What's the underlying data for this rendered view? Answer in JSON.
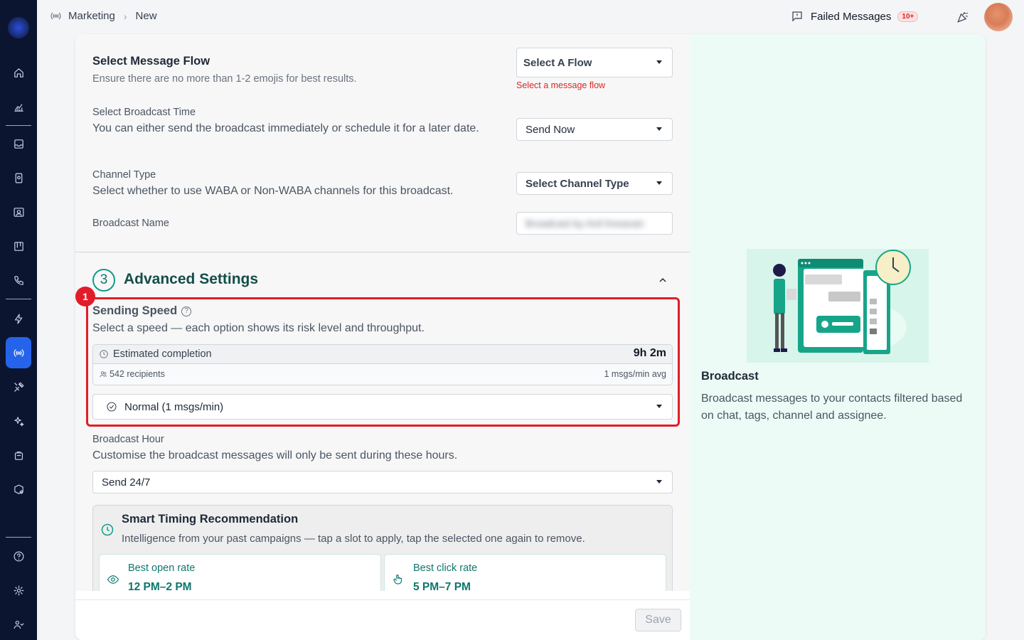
{
  "breadcrumb": {
    "section": "Marketing",
    "page": "New"
  },
  "header": {
    "failed_label": "Failed Messages",
    "failed_badge": "10+"
  },
  "sidebar": {
    "icons": [
      "home-icon",
      "analytics-icon",
      "inbox-icon",
      "contacts-icon",
      "contact-card-icon",
      "board-icon",
      "phone-icon",
      "bolt-icon",
      "broadcast-icon",
      "tools-icon",
      "sparkle-icon",
      "bag-icon",
      "package-settings-icon",
      "help-icon",
      "settings-icon",
      "team-icon"
    ],
    "active": "broadcast-icon"
  },
  "form": {
    "flow": {
      "title": "Select Message Flow",
      "hint": "Ensure there are no more than 1-2 emojis for best results.",
      "value": "Select A Flow",
      "error": "Select a message flow"
    },
    "time": {
      "label": "Select Broadcast Time",
      "desc": "You can either send the broadcast immediately or schedule it for a later date.",
      "value": "Send Now"
    },
    "channel": {
      "label": "Channel Type",
      "desc": "Select whether to use WABA or Non-WABA channels for this broadcast.",
      "value": "Select Channel Type"
    },
    "name": {
      "label": "Broadcast Name",
      "value": "Broadcast by Anil Kesavan"
    }
  },
  "advanced": {
    "step": "3",
    "title": "Advanced Settings",
    "highlight_number": "1",
    "speed": {
      "title": "Sending Speed",
      "desc": "Select a speed — each option shows its risk level and throughput.",
      "est_label": "Estimated completion",
      "est_value": "9h 2m",
      "recipients": "542 recipients",
      "avg": "1 msgs/min avg",
      "value": "Normal (1 msgs/min)"
    },
    "hour": {
      "label": "Broadcast Hour",
      "desc": "Customise the broadcast messages will only be sent during these hours.",
      "value": "Send 24/7"
    },
    "smart": {
      "title": "Smart Timing Recommendation",
      "desc": "Intelligence from your past campaigns — tap a slot to apply, tap the selected one again to remove.",
      "slots": [
        {
          "label": "Best open rate",
          "value": "12 PM–2 PM"
        },
        {
          "label": "Best click rate",
          "value": "5 PM–7 PM"
        }
      ]
    }
  },
  "footer": {
    "save_label": "Save"
  },
  "info": {
    "title": "Broadcast",
    "desc": "Broadcast messages to your contacts filtered based on chat, tags, channel and assignee."
  },
  "colors": {
    "accent": "#0f9d8a",
    "sidebar": "#0b1530",
    "active": "#2563eb",
    "highlight": "#e11d2a",
    "error": "#dc2626"
  }
}
